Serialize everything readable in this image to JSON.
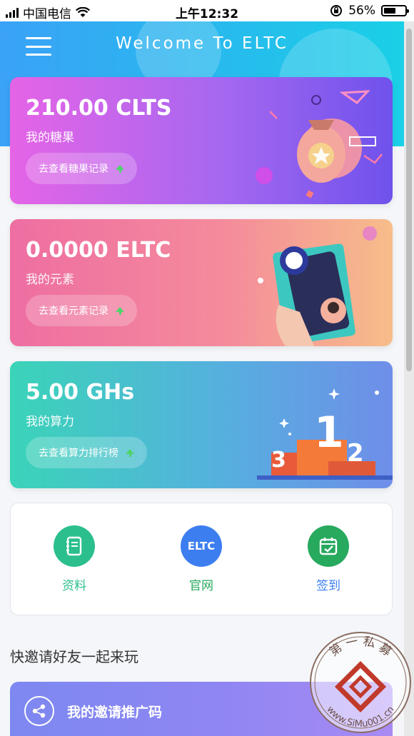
{
  "status_bar": {
    "carrier": "中国电信",
    "time": "上午12:32",
    "battery": "56%",
    "battery_level": 0.56
  },
  "header": {
    "title": "Welcome To ELTC"
  },
  "cards": [
    {
      "value": "210.00 CLTS",
      "label": "我的糖果",
      "action": "去查看糖果记录"
    },
    {
      "value": "0.0000 ELTC",
      "label": "我的元素",
      "action": "去查看元素记录"
    },
    {
      "value": "5.00 GHs",
      "label": "我的算力",
      "action": "去查看算力排行榜"
    }
  ],
  "shortcuts": [
    {
      "label": "资料",
      "icon": "notebook-icon",
      "color": "#2bbf8d"
    },
    {
      "label": "官网",
      "icon_text": "ELTC",
      "icon": "eltc-logo-icon",
      "color": "#3c7ef0"
    },
    {
      "label": "签到",
      "icon": "calendar-check-icon",
      "color": "#27a95e"
    }
  ],
  "shortcut_label_colors": [
    "#2bbf8d",
    "#27a95e",
    "#3c7ef0"
  ],
  "invite": {
    "section_title": "快邀请好友一起来玩",
    "card_label": "我的邀请推广码"
  },
  "watermark": {
    "top_text": "第 一 私 募",
    "bottom_text": "www.SiMu001.cn"
  }
}
